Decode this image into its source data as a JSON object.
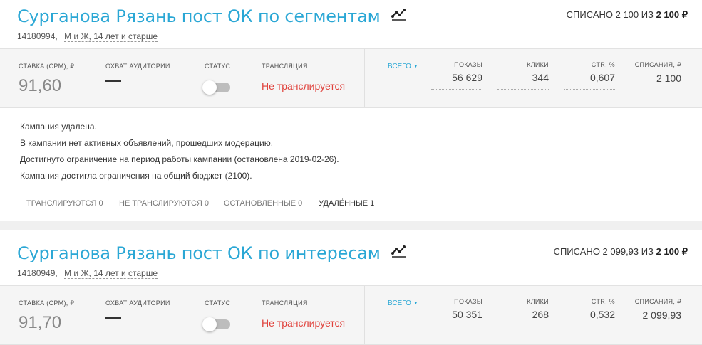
{
  "campaigns": [
    {
      "title": "Сурганова Рязань пост ОК по сегментам",
      "id": "14180994,",
      "audience": "М и Ж, 14 лет и старше",
      "spent_prefix": "СПИСАНО 2 100 ИЗ",
      "spent_total": "2 100 ₽",
      "labels": {
        "bid": "СТАВКА (CPM), ₽",
        "reach": "ОХВАТ АУДИТОРИИ",
        "status": "СТАТУС",
        "broadcast": "ТРАНСЛЯЦИЯ"
      },
      "bid": "91,60",
      "reach": "—",
      "broadcast_status": "Не транслируется",
      "period": "ВСЕГО",
      "columns": [
        {
          "label": "ПОКАЗЫ",
          "value": "56 629"
        },
        {
          "label": "КЛИКИ",
          "value": "344"
        },
        {
          "label": "CTR, %",
          "value": "0,607"
        },
        {
          "label": "СПИСАНИЯ, ₽",
          "value": "2 100"
        }
      ],
      "messages": [
        "Кампания удалена.",
        "В кампании нет активных объявлений, прошедших модерацию.",
        "Достигнуто ограничение на период работы кампании (остановлена 2019-02-26).",
        "Кампания достигла ограничения на общий бюджет (2100)."
      ],
      "tabs": [
        {
          "label": "ТРАНСЛИРУЮТСЯ 0"
        },
        {
          "label": "НЕ ТРАНСЛИРУЮТСЯ 0"
        },
        {
          "label": "ОСТАНОВЛЕННЫЕ 0"
        },
        {
          "label": "УДАЛЁННЫЕ 1"
        }
      ]
    },
    {
      "title": "Сурганова Рязань пост ОК по интересам",
      "id": "14180949,",
      "audience": "М и Ж, 14 лет и старше",
      "spent_prefix": "СПИСАНО 2 099,93 ИЗ",
      "spent_total": "2 100 ₽",
      "labels": {
        "bid": "СТАВКА (CPM), ₽",
        "reach": "ОХВАТ АУДИТОРИИ",
        "status": "СТАТУС",
        "broadcast": "ТРАНСЛЯЦИЯ"
      },
      "bid": "91,70",
      "reach": "—",
      "broadcast_status": "Не транслируется",
      "period": "ВСЕГО",
      "columns": [
        {
          "label": "ПОКАЗЫ",
          "value": "50 351"
        },
        {
          "label": "КЛИКИ",
          "value": "268"
        },
        {
          "label": "CTR, %",
          "value": "0,532"
        },
        {
          "label": "СПИСАНИЯ, ₽",
          "value": "2 099,93"
        }
      ]
    }
  ],
  "colors": {
    "accent": "#2aa7d5",
    "error": "#e0413b",
    "panel": "#f5f5f5"
  },
  "icons": {
    "chart": "chart-line-icon",
    "caret": "caret-down-icon"
  }
}
